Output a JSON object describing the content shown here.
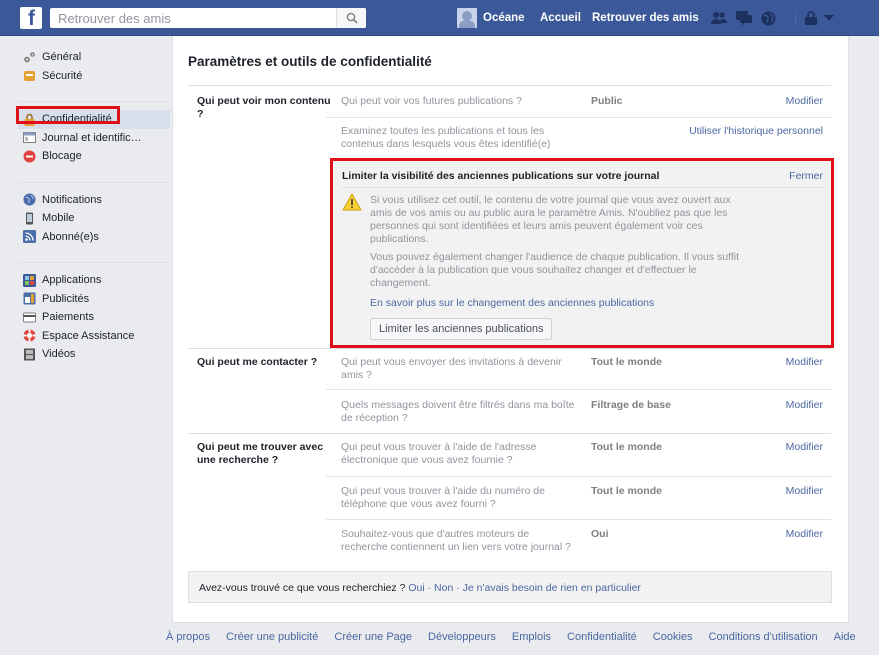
{
  "header": {
    "search_placeholder": "Retrouver des amis",
    "user_name": "Océane",
    "home": "Accueil",
    "find_friends": "Retrouver des amis"
  },
  "sidebar": {
    "groups": [
      [
        {
          "label": "Général",
          "icon": "gear-icon"
        },
        {
          "label": "Sécurité",
          "icon": "badge-icon"
        }
      ],
      [
        {
          "label": "Confidentialité",
          "icon": "lock-icon",
          "active": true
        },
        {
          "label": "Journal et identific…",
          "icon": "timeline-icon"
        },
        {
          "label": "Blocage",
          "icon": "block-icon"
        }
      ],
      [
        {
          "label": "Notifications",
          "icon": "globe-icon"
        },
        {
          "label": "Mobile",
          "icon": "phone-icon"
        },
        {
          "label": "Abonné(e)s",
          "icon": "rss-icon"
        }
      ],
      [
        {
          "label": "Applications",
          "icon": "apps-icon"
        },
        {
          "label": "Publicités",
          "icon": "ads-icon"
        },
        {
          "label": "Paiements",
          "icon": "card-icon"
        },
        {
          "label": "Espace Assistance",
          "icon": "lifebuoy-icon"
        },
        {
          "label": "Vidéos",
          "icon": "film-icon"
        }
      ]
    ]
  },
  "main": {
    "title": "Paramètres et outils de confidentialité",
    "sections": {
      "content": {
        "label": "Qui peut voir mon contenu ?",
        "rows": [
          {
            "question": "Qui peut voir vos futures publications ?",
            "value": "Public",
            "action": "Modifier"
          },
          {
            "question": "Examinez toutes les publications et tous les contenus dans lesquels vous êtes identifié(e)",
            "value": "",
            "action": "Utiliser l'historique personnel"
          }
        ]
      },
      "limit": {
        "title": "Limiter la visibilité des anciennes publications sur votre journal",
        "close": "Fermer",
        "p1": "Si vous utilisez cet outil, le contenu de votre journal que vous avez ouvert aux amis de vos amis ou au public aura le paramètre Amis. N'oubliez pas que les personnes qui sont identifiées et leurs amis peuvent également voir ces publications.",
        "p2": "Vous pouvez également changer l'audience de chaque publication. Il vous suffit d'accéder à la publication que vous souhaitez changer et d'effectuer le changement.",
        "link": "En savoir plus sur le changement des anciennes publications",
        "button": "Limiter les anciennes publications"
      },
      "contact": {
        "label": "Qui peut me contacter ?",
        "rows": [
          {
            "question": "Qui peut vous envoyer des invitations à devenir amis ?",
            "value": "Tout le monde",
            "action": "Modifier"
          },
          {
            "question": "Quels messages doivent être filtrés dans ma boîte de réception ?",
            "value": "Filtrage de base",
            "action": "Modifier"
          }
        ]
      },
      "lookup": {
        "label": "Qui peut me trouver avec une recherche ?",
        "rows": [
          {
            "question": "Qui peut vous trouver à l'aide de l'adresse électronique que vous avez fournie ?",
            "value": "Tout le monde",
            "action": "Modifier"
          },
          {
            "question": "Qui peut vous trouver à l'aide du numéro de téléphone que vous avez fourni ?",
            "value": "Tout le monde",
            "action": "Modifier"
          },
          {
            "question": "Souhaitez-vous que d'autres moteurs de recherche contiennent un lien vers votre journal ?",
            "value": "Oui",
            "action": "Modifier"
          }
        ]
      }
    },
    "help": {
      "question": "Avez-vous trouvé ce que vous recherchiez ?",
      "yes": "Oui",
      "sep1": "·",
      "no": "Non",
      "sep2": "·",
      "other": "Je n'avais besoin de rien en particulier"
    }
  },
  "footer": [
    "À propos",
    "Créer une publicité",
    "Créer une Page",
    "Développeurs",
    "Emplois",
    "Confidentialité",
    "Cookies",
    "Conditions d'utilisation",
    "Aide"
  ],
  "colors": {
    "brand": "#3b5998",
    "link": "#4b67a1",
    "highlight": "#e0101a"
  }
}
